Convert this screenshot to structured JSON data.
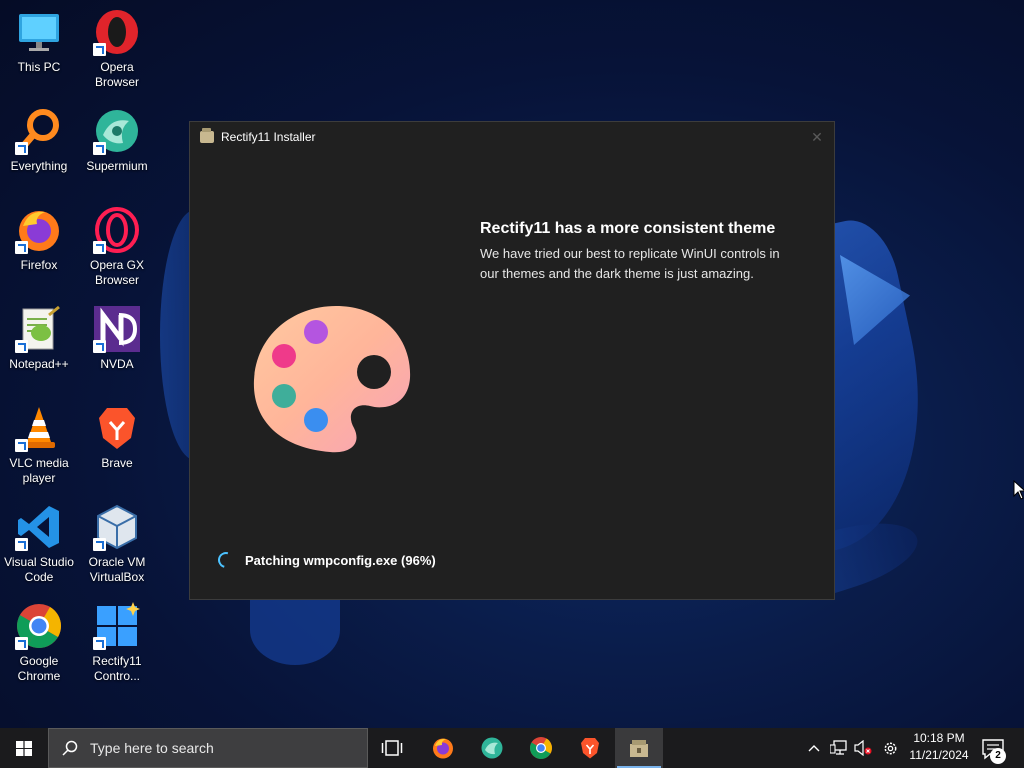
{
  "desktop": {
    "icons": [
      {
        "label": "This PC",
        "icon": "monitor-icon"
      },
      {
        "label": "Opera Browser",
        "icon": "opera-icon"
      },
      {
        "label": "Everything",
        "icon": "everything-search-icon"
      },
      {
        "label": "Supermium",
        "icon": "supermium-icon"
      },
      {
        "label": "Firefox",
        "icon": "firefox-icon"
      },
      {
        "label": "Opera GX Browser",
        "icon": "opera-gx-icon"
      },
      {
        "label": "Notepad++",
        "icon": "notepadpp-icon"
      },
      {
        "label": "NVDA",
        "icon": "nvda-icon"
      },
      {
        "label": "VLC media player",
        "icon": "vlc-cone-icon"
      },
      {
        "label": "Brave",
        "icon": "brave-lion-icon"
      },
      {
        "label": "Visual Studio Code",
        "icon": "vscode-icon"
      },
      {
        "label": "Oracle VM VirtualBox",
        "icon": "virtualbox-cube-icon"
      },
      {
        "label": "Google Chrome",
        "icon": "chrome-icon"
      },
      {
        "label": "Rectify11 Contro...",
        "icon": "rectify11-control-icon"
      }
    ]
  },
  "installer": {
    "title": "Rectify11 Installer",
    "close_glyph": "✕",
    "heading": "Rectify11 has a more consistent theme",
    "description": "We have tried our best to replicate WinUI controls in our themes and the dark theme is just amazing.",
    "status": "Patching wmpconfig.exe (96%)",
    "progress_percent": 96,
    "accent": "#4cc2ff"
  },
  "taskbar": {
    "search_placeholder": "Type here to search",
    "pinned": [
      "task-view-icon",
      "firefox-icon",
      "supermium-icon",
      "chrome-icon",
      "brave-icon",
      "rectify11-installer-icon"
    ],
    "active": "rectify11-installer-icon",
    "tray": [
      "chevron-up-icon",
      "network-icon",
      "volume-muted-icon",
      "settings-gear-icon"
    ],
    "time": "10:18 PM",
    "date": "11/21/2024",
    "notification_count": "2"
  }
}
